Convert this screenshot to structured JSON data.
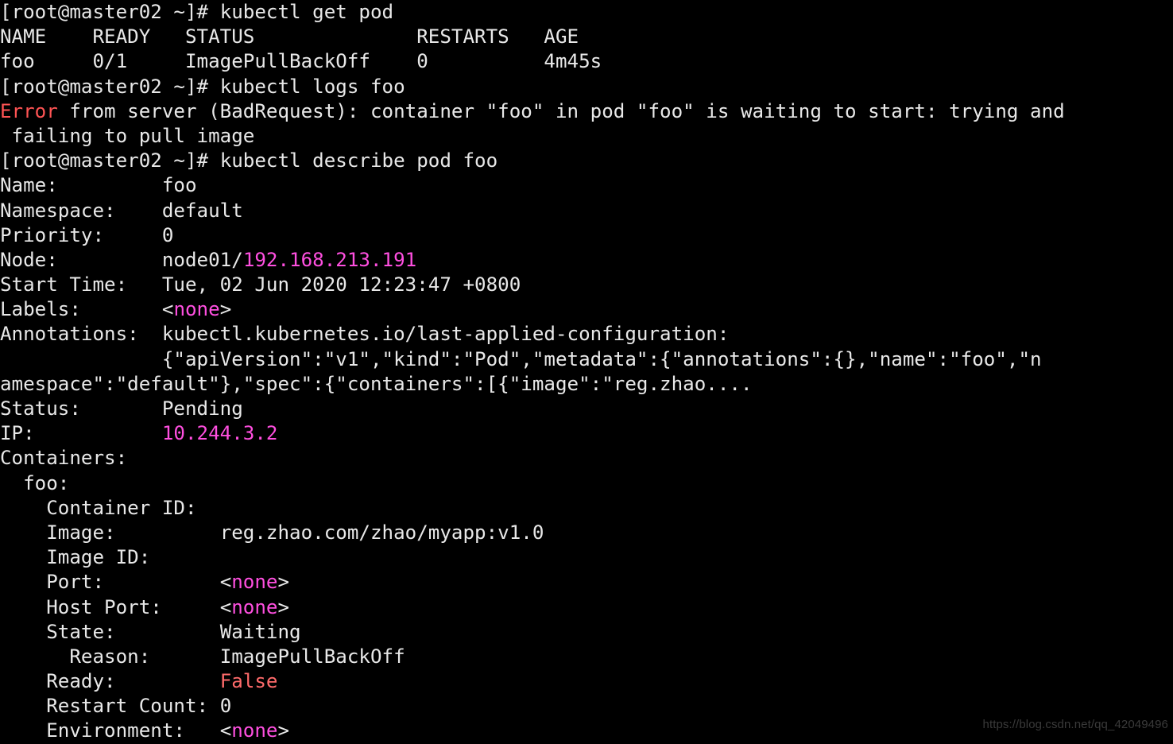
{
  "terminal": {
    "title": "kubectl describe pod foo — terminal",
    "background_color": "#000000",
    "foreground_color": "#e8e8e8",
    "error_color": "#ff5454",
    "magenta_color": "#ff4fe0",
    "false_color": "#ff6b6b",
    "prompt": "[root@master02 ~]#",
    "hostname": "master02",
    "user": "root",
    "cwd": "~"
  },
  "commands": {
    "get_pod": "kubectl get pod",
    "logs": "kubectl logs foo",
    "describe": "kubectl describe pod foo"
  },
  "pod_table": {
    "header": "NAME    READY   STATUS              RESTARTS   AGE",
    "row": "foo     0/1     ImagePullBackOff    0          4m45s",
    "columns": [
      "NAME",
      "READY",
      "STATUS",
      "RESTARTS",
      "AGE"
    ],
    "values": [
      "foo",
      "0/1",
      "ImagePullBackOff",
      "0",
      "4m45s"
    ]
  },
  "logs_error": {
    "keyword": "Error",
    "rest_line1": " from server (BadRequest): container \"foo\" in pod \"foo\" is waiting to start: trying and",
    "line2": " failing to pull image"
  },
  "describe": {
    "name_label": "Name:         ",
    "name_value": "foo",
    "namespace_label": "Namespace:    ",
    "namespace_value": "default",
    "priority_label": "Priority:     ",
    "priority_value": "0",
    "node_label": "Node:         ",
    "node_value_plain": "node01/",
    "node_value_ip": "192.168.213.191",
    "start_time_label": "Start Time:   ",
    "start_time_value": "Tue, 02 Jun 2020 12:23:47 +0800",
    "labels_label": "Labels:       ",
    "labels_value": "none",
    "annotations_label": "Annotations:  ",
    "annotations_value": "kubectl.kubernetes.io/last-applied-configuration:",
    "annotations_json_line1": "              {\"apiVersion\":\"v1\",\"kind\":\"Pod\",\"metadata\":{\"annotations\":{},\"name\":\"foo\",\"n",
    "annotations_json_line2": "amespace\":\"default\"},\"spec\":{\"containers\":[{\"image\":\"reg.zhao....",
    "status_label": "Status:       ",
    "status_value": "Pending",
    "ip_label": "IP:           ",
    "ip_value": "10.244.3.2",
    "containers_header": "Containers:",
    "container_name": "  foo:",
    "container_id_label": "    Container ID:  ",
    "container_id_value": "",
    "image_label": "    Image:         ",
    "image_value": "reg.zhao.com/zhao/myapp:v1.0",
    "image_id_label": "    Image ID:      ",
    "image_id_value": "",
    "port_label": "    Port:          ",
    "port_value": "none",
    "host_port_label": "    Host Port:     ",
    "host_port_value": "none",
    "state_label": "    State:         ",
    "state_value": "Waiting",
    "reason_label": "      Reason:      ",
    "reason_value": "ImagePullBackOff",
    "ready_label": "    Ready:         ",
    "ready_value": "False",
    "restart_count_label": "    Restart Count: ",
    "restart_count_value": "0",
    "environment_label": "    Environment:   ",
    "environment_value": "none"
  },
  "watermark": "https://blog.csdn.net/qq_42049496"
}
